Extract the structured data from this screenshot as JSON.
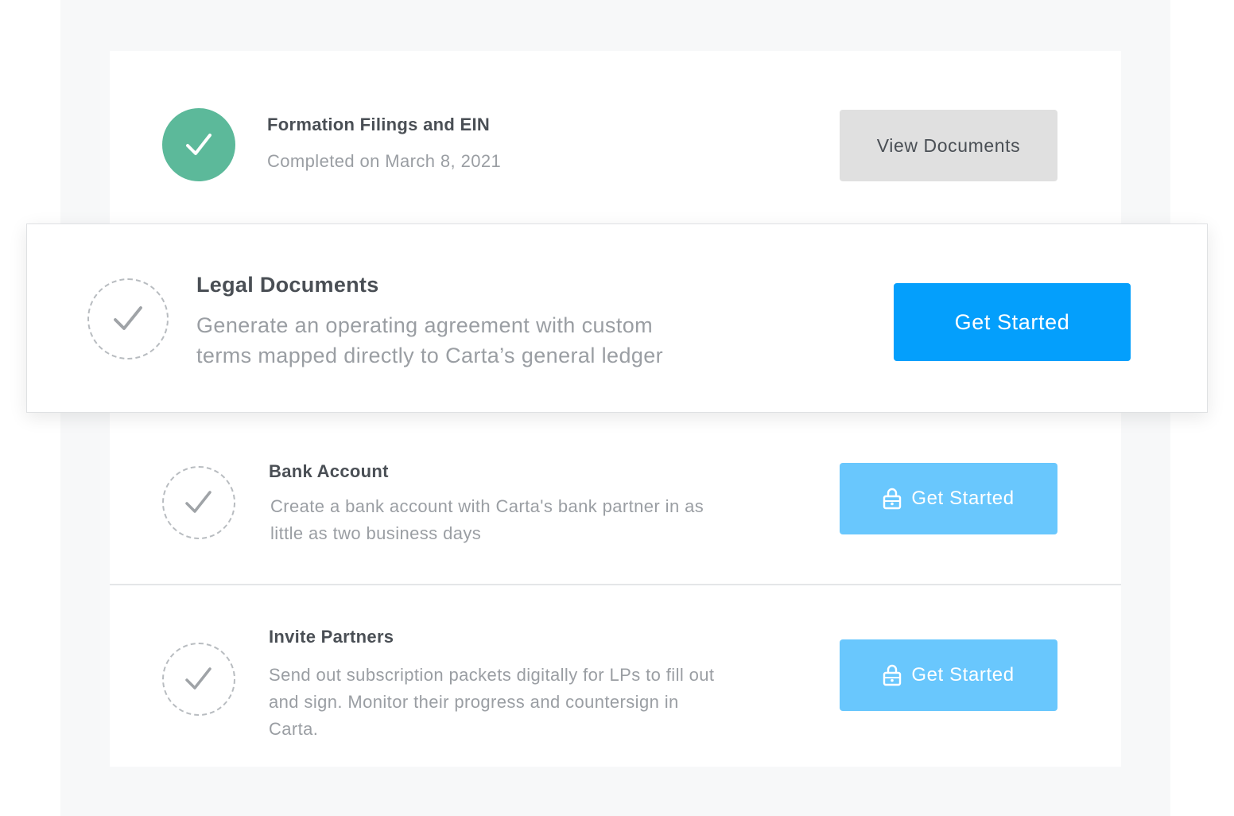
{
  "steps": [
    {
      "title": "Formation Filings and EIN",
      "description": "Completed on March 8, 2021",
      "status": "completed",
      "button_label": "View Documents",
      "button_locked": false
    },
    {
      "title": "Legal Documents",
      "description_line1": "Generate an operating agreement with custom",
      "description_line2": "terms mapped directly to Carta’s general ledger",
      "status": "pending",
      "button_label": "Get Started",
      "button_locked": false
    },
    {
      "title": "Bank Account",
      "description_line1": "Create a bank account with Carta's bank partner in as",
      "description_line2": "little as two business days",
      "status": "locked",
      "button_label": "Get Started",
      "button_locked": true
    },
    {
      "title": "Invite Partners",
      "description_line1": "Send out subscription packets digitally for LPs to fill out",
      "description_line2": "and sign. Monitor their progress and countersign in",
      "description_line3": "Carta.",
      "status": "locked",
      "button_label": "Get Started",
      "button_locked": true
    }
  ],
  "colors": {
    "completed": "#5cb99a",
    "primary_button": "#049ffc",
    "locked_button": "#69c7fd",
    "secondary_button": "#e0e0e0"
  },
  "icons": {
    "completed": "check-icon",
    "pending": "check-icon",
    "locked_button": "lock-icon"
  }
}
